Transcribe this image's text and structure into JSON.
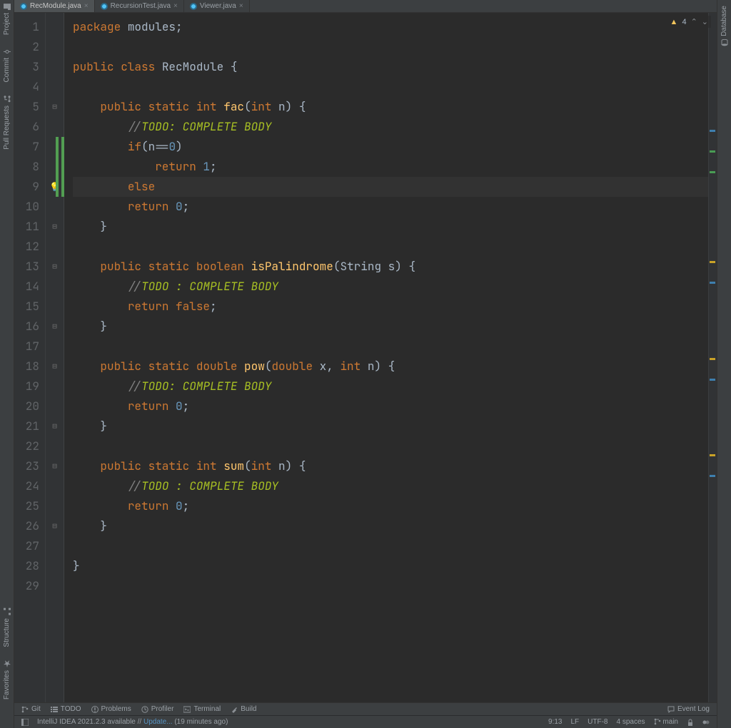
{
  "left_rail": {
    "top": [
      {
        "label": "Project"
      },
      {
        "label": "Commit"
      },
      {
        "label": "Pull Requests"
      }
    ],
    "bottom": [
      {
        "label": "Structure"
      },
      {
        "label": "Favorites"
      }
    ]
  },
  "right_rail": [
    {
      "label": "Database"
    }
  ],
  "tabs": [
    {
      "label": "RecModule.java",
      "active": true
    },
    {
      "label": "RecursionTest.java",
      "active": false
    },
    {
      "label": "Viewer.java",
      "active": false
    }
  ],
  "inspection_bar": {
    "icon": "warning",
    "count": "4"
  },
  "gutter": {
    "line_count": 29,
    "fold_minus_lines": [
      5,
      11,
      13,
      16,
      18,
      21,
      23,
      26
    ],
    "bulb_line": 9,
    "green_change_lines": [
      7,
      8,
      9
    ]
  },
  "code_lines": [
    [
      [
        "kw",
        "package "
      ],
      [
        "pkg",
        "modules"
      ],
      [
        "punc",
        ";"
      ]
    ],
    [
      [
        "",
        ""
      ]
    ],
    [
      [
        "kw",
        "public class "
      ],
      [
        "pkg",
        "RecModule "
      ],
      [
        "punc",
        "{"
      ]
    ],
    [
      [
        "",
        ""
      ]
    ],
    [
      [
        "",
        "    "
      ],
      [
        "kw",
        "public static "
      ],
      [
        "type",
        "int "
      ],
      [
        "method",
        "fac"
      ],
      [
        "punc",
        "("
      ],
      [
        "type",
        "int "
      ],
      [
        "param",
        "n"
      ],
      [
        "punc",
        ") {"
      ]
    ],
    [
      [
        "",
        "        "
      ],
      [
        "comment",
        "//"
      ],
      [
        "todo",
        "TODO: COMPLETE BODY"
      ]
    ],
    [
      [
        "",
        "        "
      ],
      [
        "kw",
        "if"
      ],
      [
        "punc",
        "("
      ],
      [
        "param",
        "n"
      ],
      [
        "punc",
        "=="
      ],
      [
        "num",
        "0"
      ],
      [
        "punc",
        ")"
      ]
    ],
    [
      [
        "",
        "            "
      ],
      [
        "kw",
        "return "
      ],
      [
        "num",
        "1"
      ],
      [
        "punc",
        ";"
      ]
    ],
    [
      [
        "",
        "        "
      ],
      [
        "kw",
        "else"
      ]
    ],
    [
      [
        "",
        "        "
      ],
      [
        "kw",
        "return "
      ],
      [
        "num",
        "0"
      ],
      [
        "punc",
        ";"
      ]
    ],
    [
      [
        "",
        "    "
      ],
      [
        "punc",
        "}"
      ]
    ],
    [
      [
        "",
        ""
      ]
    ],
    [
      [
        "",
        "    "
      ],
      [
        "kw",
        "public static "
      ],
      [
        "type",
        "boolean "
      ],
      [
        "method",
        "isPalindrome"
      ],
      [
        "punc",
        "("
      ],
      [
        "pkg",
        "String "
      ],
      [
        "param",
        "s"
      ],
      [
        "punc",
        ") {"
      ]
    ],
    [
      [
        "",
        "        "
      ],
      [
        "comment",
        "//"
      ],
      [
        "todo",
        "TODO : COMPLETE BODY"
      ]
    ],
    [
      [
        "",
        "        "
      ],
      [
        "kw",
        "return "
      ],
      [
        "bool",
        "false"
      ],
      [
        "punc",
        ";"
      ]
    ],
    [
      [
        "",
        "    "
      ],
      [
        "punc",
        "}"
      ]
    ],
    [
      [
        "",
        ""
      ]
    ],
    [
      [
        "",
        "    "
      ],
      [
        "kw",
        "public static "
      ],
      [
        "type",
        "double "
      ],
      [
        "method",
        "pow"
      ],
      [
        "punc",
        "("
      ],
      [
        "type",
        "double "
      ],
      [
        "param",
        "x"
      ],
      [
        "punc",
        ", "
      ],
      [
        "type",
        "int "
      ],
      [
        "param",
        "n"
      ],
      [
        "punc",
        ") {"
      ]
    ],
    [
      [
        "",
        "        "
      ],
      [
        "comment",
        "//"
      ],
      [
        "todo",
        "TODO: COMPLETE BODY"
      ]
    ],
    [
      [
        "",
        "        "
      ],
      [
        "kw",
        "return "
      ],
      [
        "num",
        "0"
      ],
      [
        "punc",
        ";"
      ]
    ],
    [
      [
        "",
        "    "
      ],
      [
        "punc",
        "}"
      ]
    ],
    [
      [
        "",
        ""
      ]
    ],
    [
      [
        "",
        "    "
      ],
      [
        "kw",
        "public static "
      ],
      [
        "type",
        "int "
      ],
      [
        "method",
        "sum"
      ],
      [
        "punc",
        "("
      ],
      [
        "type",
        "int "
      ],
      [
        "param",
        "n"
      ],
      [
        "punc",
        ") {"
      ]
    ],
    [
      [
        "",
        "        "
      ],
      [
        "comment",
        "//"
      ],
      [
        "todo",
        "TODO : COMPLETE BODY"
      ]
    ],
    [
      [
        "",
        "        "
      ],
      [
        "kw",
        "return "
      ],
      [
        "num",
        "0"
      ],
      [
        "punc",
        ";"
      ]
    ],
    [
      [
        "",
        "    "
      ],
      [
        "punc",
        "}"
      ]
    ],
    [
      [
        "",
        ""
      ]
    ],
    [
      [
        "punc",
        "}"
      ]
    ],
    [
      [
        "",
        ""
      ]
    ]
  ],
  "stripe_marks": [
    {
      "pct": 17,
      "cls": "m-blue"
    },
    {
      "pct": 20,
      "cls": "m-green"
    },
    {
      "pct": 23,
      "cls": "m-green"
    },
    {
      "pct": 36,
      "cls": "m-yellow"
    },
    {
      "pct": 39,
      "cls": "m-blue"
    },
    {
      "pct": 50,
      "cls": "m-yellow"
    },
    {
      "pct": 53,
      "cls": "m-blue"
    },
    {
      "pct": 64,
      "cls": "m-yellow"
    },
    {
      "pct": 67,
      "cls": "m-blue"
    }
  ],
  "bottom_tools": {
    "left": [
      {
        "label": "Git",
        "icon": "branch"
      },
      {
        "label": "TODO",
        "icon": "list"
      },
      {
        "label": "Problems",
        "icon": "warn"
      },
      {
        "label": "Profiler",
        "icon": "clock"
      },
      {
        "label": "Terminal",
        "icon": "term"
      },
      {
        "label": "Build",
        "icon": "hammer"
      }
    ],
    "right": [
      {
        "label": "Event Log",
        "icon": "bubble"
      }
    ]
  },
  "status": {
    "update_prefix": "IntelliJ IDEA 2021.2.3 available // ",
    "update_link": "Update...",
    "update_suffix": " (19 minutes ago)",
    "cursor": "9:13",
    "line_sep": "LF",
    "encoding": "UTF-8",
    "indent": "4 spaces",
    "branch": "main"
  }
}
